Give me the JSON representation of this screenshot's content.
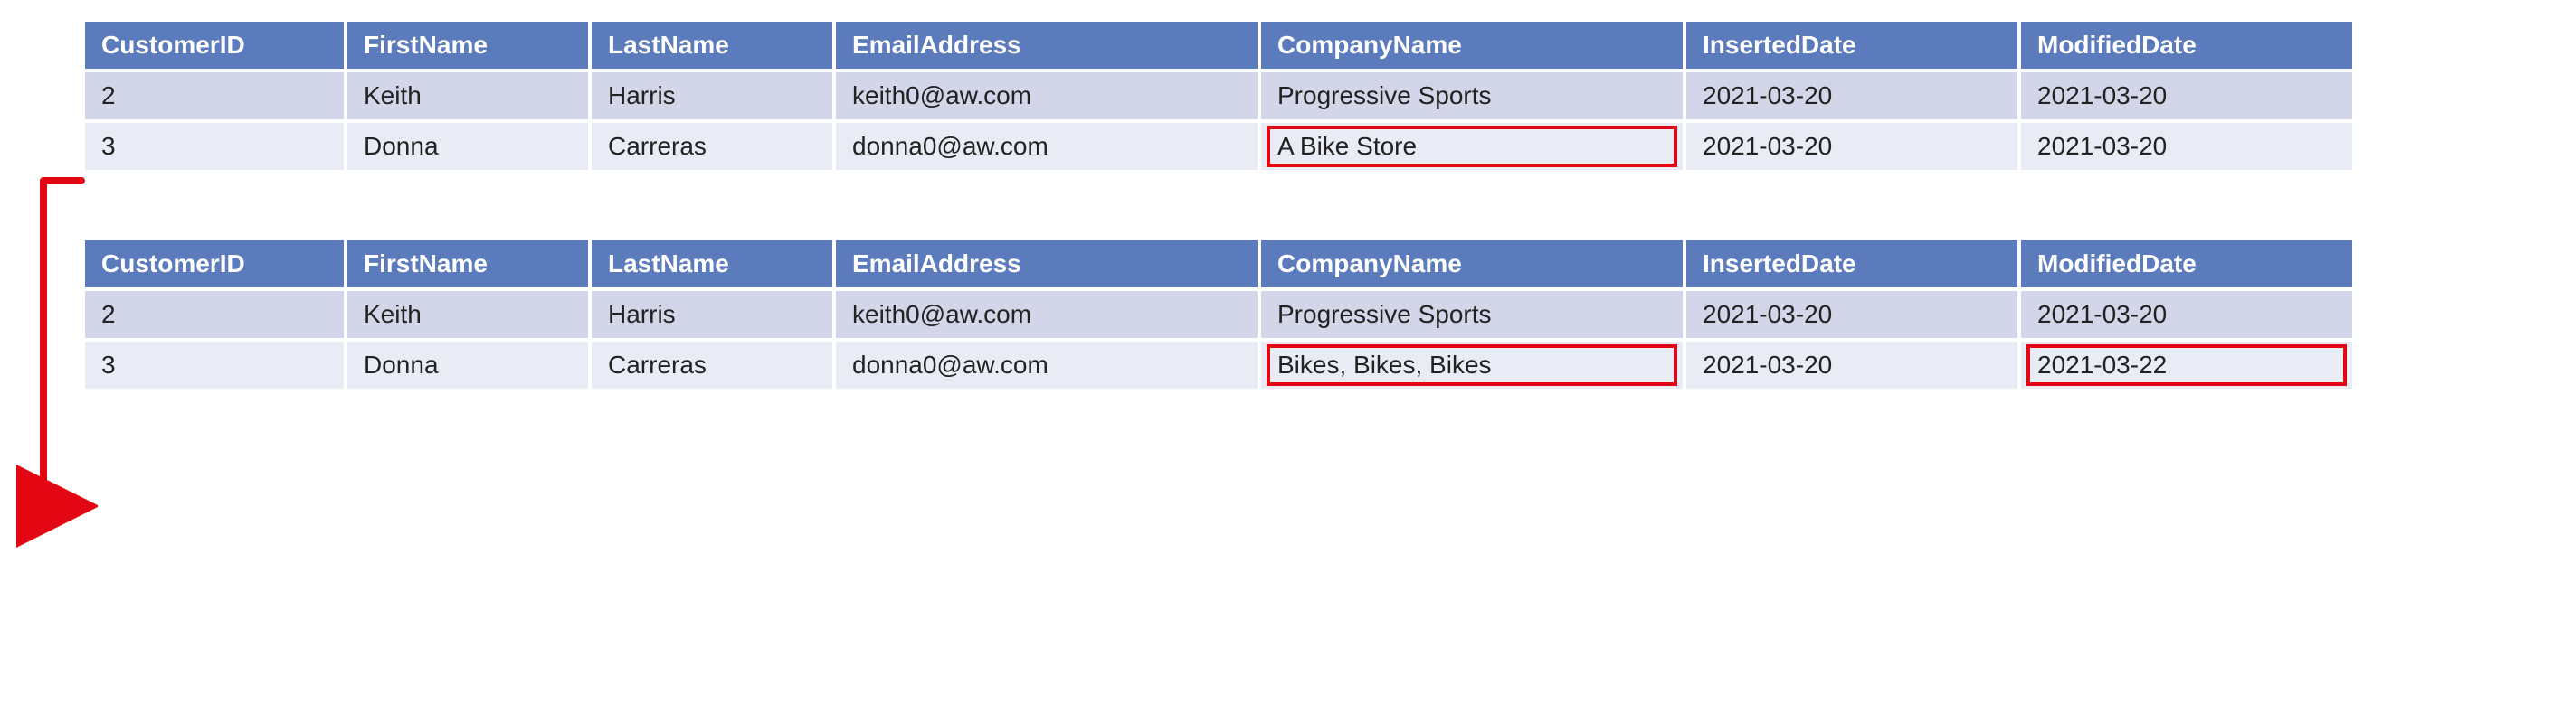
{
  "columns": [
    "CustomerID",
    "FirstName",
    "LastName",
    "EmailAddress",
    "CompanyName",
    "InsertedDate",
    "ModifiedDate"
  ],
  "tables": [
    {
      "rows": [
        {
          "cells": [
            "2",
            "Keith",
            "Harris",
            "keith0@aw.com",
            "Progressive Sports",
            "2021-03-20",
            "2021-03-20"
          ],
          "highlight": []
        },
        {
          "cells": [
            "3",
            "Donna",
            "Carreras",
            "donna0@aw.com",
            "A Bike Store",
            "2021-03-20",
            "2021-03-20"
          ],
          "highlight": [
            4
          ]
        }
      ]
    },
    {
      "rows": [
        {
          "cells": [
            "2",
            "Keith",
            "Harris",
            "keith0@aw.com",
            "Progressive Sports",
            "2021-03-20",
            "2021-03-20"
          ],
          "highlight": []
        },
        {
          "cells": [
            "3",
            "Donna",
            "Carreras",
            "donna0@aw.com",
            "Bikes, Bikes, Bikes",
            "2021-03-20",
            "2021-03-22"
          ],
          "highlight": [
            4,
            6
          ]
        }
      ]
    }
  ],
  "arrow": {
    "color": "#e30613"
  }
}
